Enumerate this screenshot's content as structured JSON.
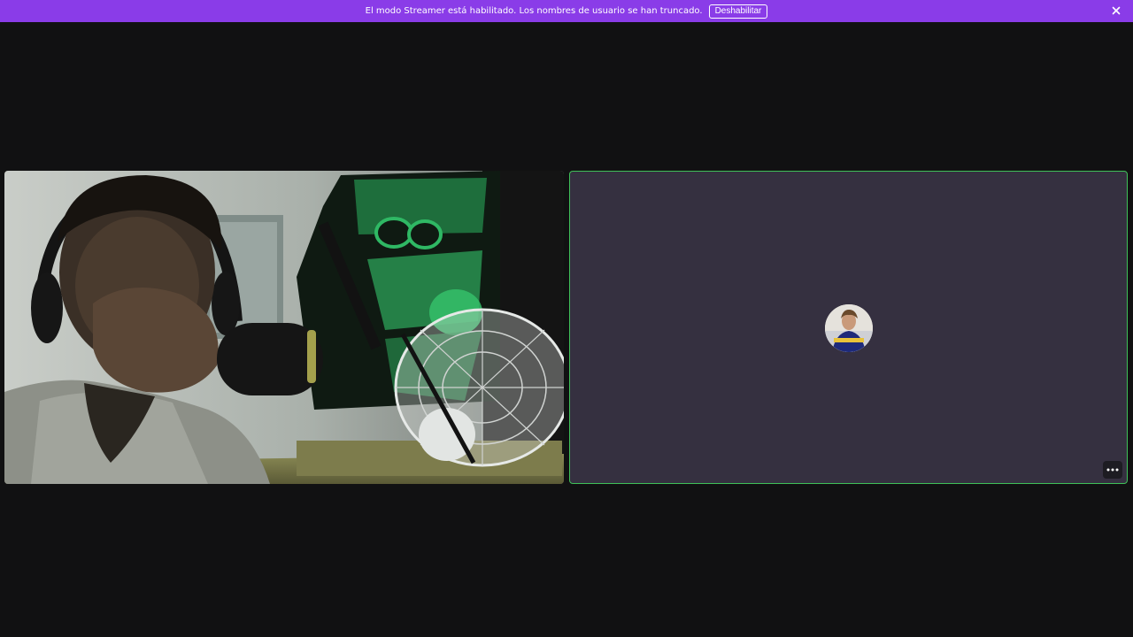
{
  "banner": {
    "message": "El modo Streamer está habilitado. Los nombres de usuario se han truncado.",
    "disable_label": "Deshabilitar",
    "close_icon": "close-icon",
    "color": "#8a3ce8"
  },
  "tiles": [
    {
      "kind": "camera-video",
      "speaking": false
    },
    {
      "kind": "audio-only-avatar",
      "speaking": true,
      "speaking_color": "#3fc058",
      "more_icon": "more-dots-icon"
    }
  ]
}
